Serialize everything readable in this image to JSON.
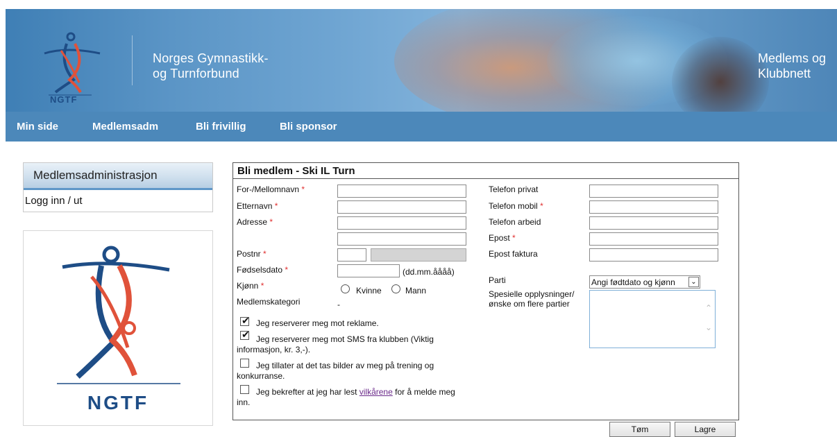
{
  "header": {
    "org_name_line1": "Norges Gymnastikk-",
    "org_name_line2": "og Turnforbund",
    "site_name_line1": "Medlems og",
    "site_name_line2": "Klubbnett",
    "logo_text": "NGTF"
  },
  "nav": {
    "items": [
      {
        "label": "Min side"
      },
      {
        "label": "Medlemsadm"
      },
      {
        "label": "Bli frivillig"
      },
      {
        "label": "Bli sponsor"
      }
    ]
  },
  "sidebar": {
    "title": "Medlemsadministrasjon",
    "login_label": "Logg inn / ut",
    "logo_text": "NGTF"
  },
  "form": {
    "title": "Bli medlem - Ski IL Turn",
    "left_fields": {
      "first_name": "For-/Mellomnavn",
      "last_name": "Etternavn",
      "address": "Adresse",
      "postcode": "Postnr",
      "birthdate": "Fødselsdato",
      "birthdate_hint": "(dd.mm.åååå)",
      "gender": "Kjønn",
      "gender_female": "Kvinne",
      "gender_male": "Mann",
      "category": "Medlemskategori",
      "category_value": "-"
    },
    "required_mark": "*",
    "right_fields": {
      "phone_private": "Telefon privat",
      "phone_mobile": "Telefon mobil",
      "phone_work": "Telefon arbeid",
      "email": "Epost",
      "email_invoice": "Epost faktura",
      "party": "Parti",
      "party_value": "Angi fødtdato og kjønn",
      "special_info_line1": "Spesielle opplysninger/",
      "special_info_line2": "ønske om flere partier"
    },
    "checkboxes": [
      {
        "line1": "Jeg reserverer meg mot reklame.",
        "line2": "",
        "checked": true
      },
      {
        "line1": "Jeg reserverer meg mot SMS fra klubben (Viktig",
        "line2": "informasjon, kr. 3,-).",
        "checked": true
      },
      {
        "line1": "Jeg tillater at det tas bilder av meg på trening og",
        "line2": "konkurranse.",
        "checked": false
      },
      {
        "line1_pre": "Jeg bekrefter at jeg har lest ",
        "link": "vilkårene",
        "line1_post": " for å melde meg",
        "line2": "inn.",
        "checked": false
      }
    ],
    "buttons": {
      "clear": "Tøm",
      "save": "Lagre"
    }
  },
  "colors": {
    "nav_bar": "#4c88ba",
    "required": "#e03030",
    "brand_blue": "#1e4d86",
    "brand_red": "#e0523a"
  }
}
